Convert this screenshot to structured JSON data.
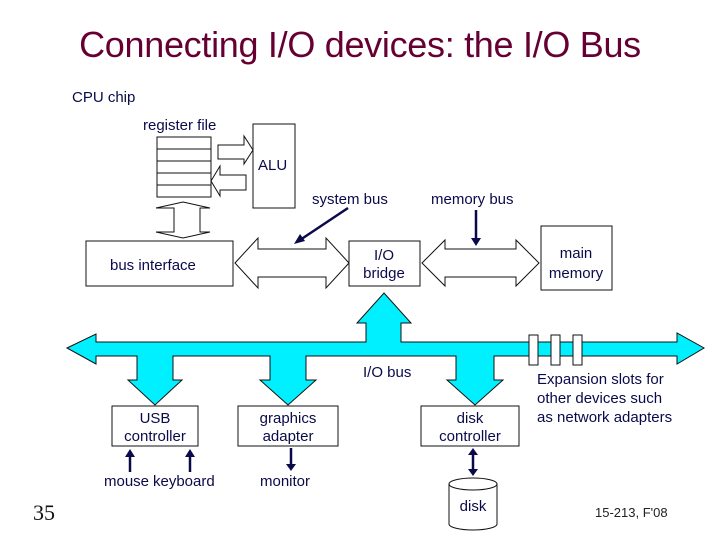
{
  "slide": {
    "title": "Connecting I/O devices: the I/O Bus",
    "number": "35",
    "footer": "15-213, F'08"
  },
  "diagram": {
    "cpu_chip_label": "CPU chip",
    "register_file_label": "register file",
    "register_rows": 5,
    "alu_label": "ALU",
    "system_bus_label": "system bus",
    "memory_bus_label": "memory bus",
    "bus_interface_label": "bus interface",
    "io_bridge_label": [
      "I/O",
      "bridge"
    ],
    "main_memory_label": [
      "main",
      "memory"
    ],
    "io_bus_label": "I/O bus",
    "expansion_slots_label": [
      "Expansion slots for",
      "other devices such",
      "as network adapters"
    ],
    "expansion_slot_count": 3,
    "usb_controller_label": [
      "USB",
      "controller"
    ],
    "graphics_adapter_label": [
      "graphics",
      "adapter"
    ],
    "disk_controller_label": [
      "disk",
      "controller"
    ],
    "mouse_label": "mouse",
    "keyboard_label": "keyboard",
    "monitor_label": "monitor",
    "disk_label": "disk",
    "colors": {
      "title": "#660033",
      "label": "#0a0a4a",
      "io_bus_fill": "#00f0ff"
    }
  }
}
